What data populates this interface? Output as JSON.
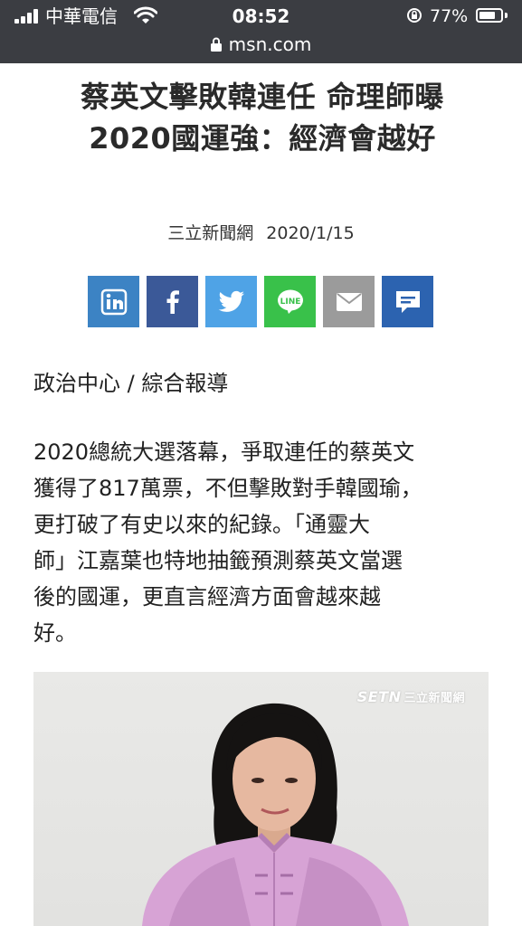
{
  "status_bar": {
    "carrier": "中華電信",
    "time": "08:52",
    "battery_percent": "77%",
    "battery_level": 0.77
  },
  "url_bar": {
    "domain": "msn.com"
  },
  "article": {
    "headline_lines": [
      "蔡英文擊敗韓連任 命理師曝",
      "2020國運強：經濟會越好"
    ],
    "source": "三立新聞網",
    "date": "2020/1/15",
    "author": "政治中心 / 綜合報導",
    "body_lines": [
      "2020總統大選落幕，爭取連任的蔡英文",
      "獲得了817萬票，不但擊敗對手韓國瑜，",
      "更打破了有史以來的紀錄。「通靈大",
      "師」江嘉葉也特地抽籤預測蔡英文當選",
      "後的國運，更直言經濟方面會越來越",
      "好。"
    ],
    "image_watermark": {
      "brand": "SETN",
      "name": "三立新聞網"
    }
  },
  "share_buttons": [
    {
      "name": "linkedin-share-button",
      "icon": "linkedin-icon",
      "label": "in",
      "color": "#3c83c4"
    },
    {
      "name": "facebook-share-button",
      "icon": "facebook-icon",
      "label": "f",
      "color": "#3b5998"
    },
    {
      "name": "twitter-share-button",
      "icon": "twitter-icon",
      "label": "",
      "color": "#4fa3e6"
    },
    {
      "name": "line-share-button",
      "icon": "line-icon",
      "label": "LINE",
      "color": "#39c14a"
    },
    {
      "name": "email-share-button",
      "icon": "mail-icon",
      "label": "",
      "color": "#9b9b9b"
    },
    {
      "name": "comment-share-button",
      "icon": "comment-icon",
      "label": "",
      "color": "#2c63b0"
    }
  ]
}
